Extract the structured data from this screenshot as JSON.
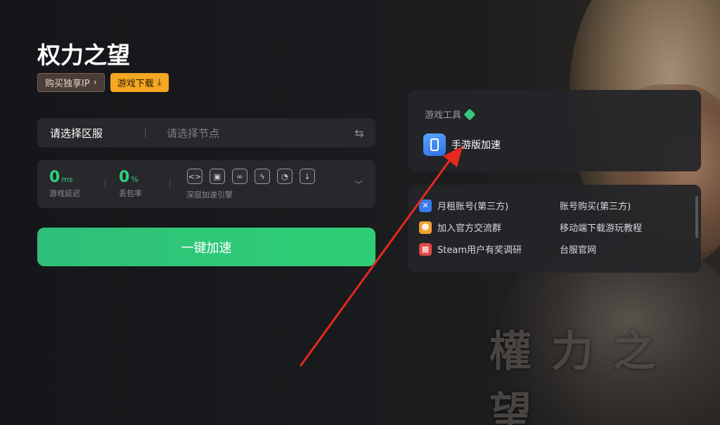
{
  "game": {
    "title": "权力之望",
    "buy_ip_label": "购买独享IP",
    "download_label": "游戏下载",
    "bg_title": "權力之望"
  },
  "server": {
    "region_placeholder": "请选择区服",
    "node_placeholder": "请选择节点"
  },
  "stats": {
    "latency_value": "0",
    "latency_unit": "ms",
    "latency_label": "游戏延迟",
    "loss_value": "0",
    "loss_unit": "%",
    "loss_label": "丢包率",
    "engine_label": "深层加速引擎",
    "engine_icons": [
      "code-icon",
      "screen-icon",
      "link-icon",
      "bolt-icon",
      "gauge-icon",
      "download-circle-icon"
    ]
  },
  "accelerate_button": "一键加速",
  "tools": {
    "title": "游戏工具",
    "items": [
      {
        "label": "手游版加速",
        "icon": "mobile-icon"
      }
    ]
  },
  "links": [
    {
      "label": "月租账号(第三方)",
      "icon": "account-icon",
      "color": "#3a7bea"
    },
    {
      "label": "账号购买(第三方)"
    },
    {
      "label": "加入官方交流群",
      "icon": "group-icon",
      "color": "#f0a030"
    },
    {
      "label": "移动端下载游玩教程"
    },
    {
      "label": "Steam用户有奖调研",
      "icon": "gift-icon",
      "color": "#e04848"
    },
    {
      "label": "台服官网"
    }
  ],
  "colors": {
    "accent_green": "#2fd081",
    "download_orange": "#f5a623",
    "arrow_red": "#e5291f"
  }
}
